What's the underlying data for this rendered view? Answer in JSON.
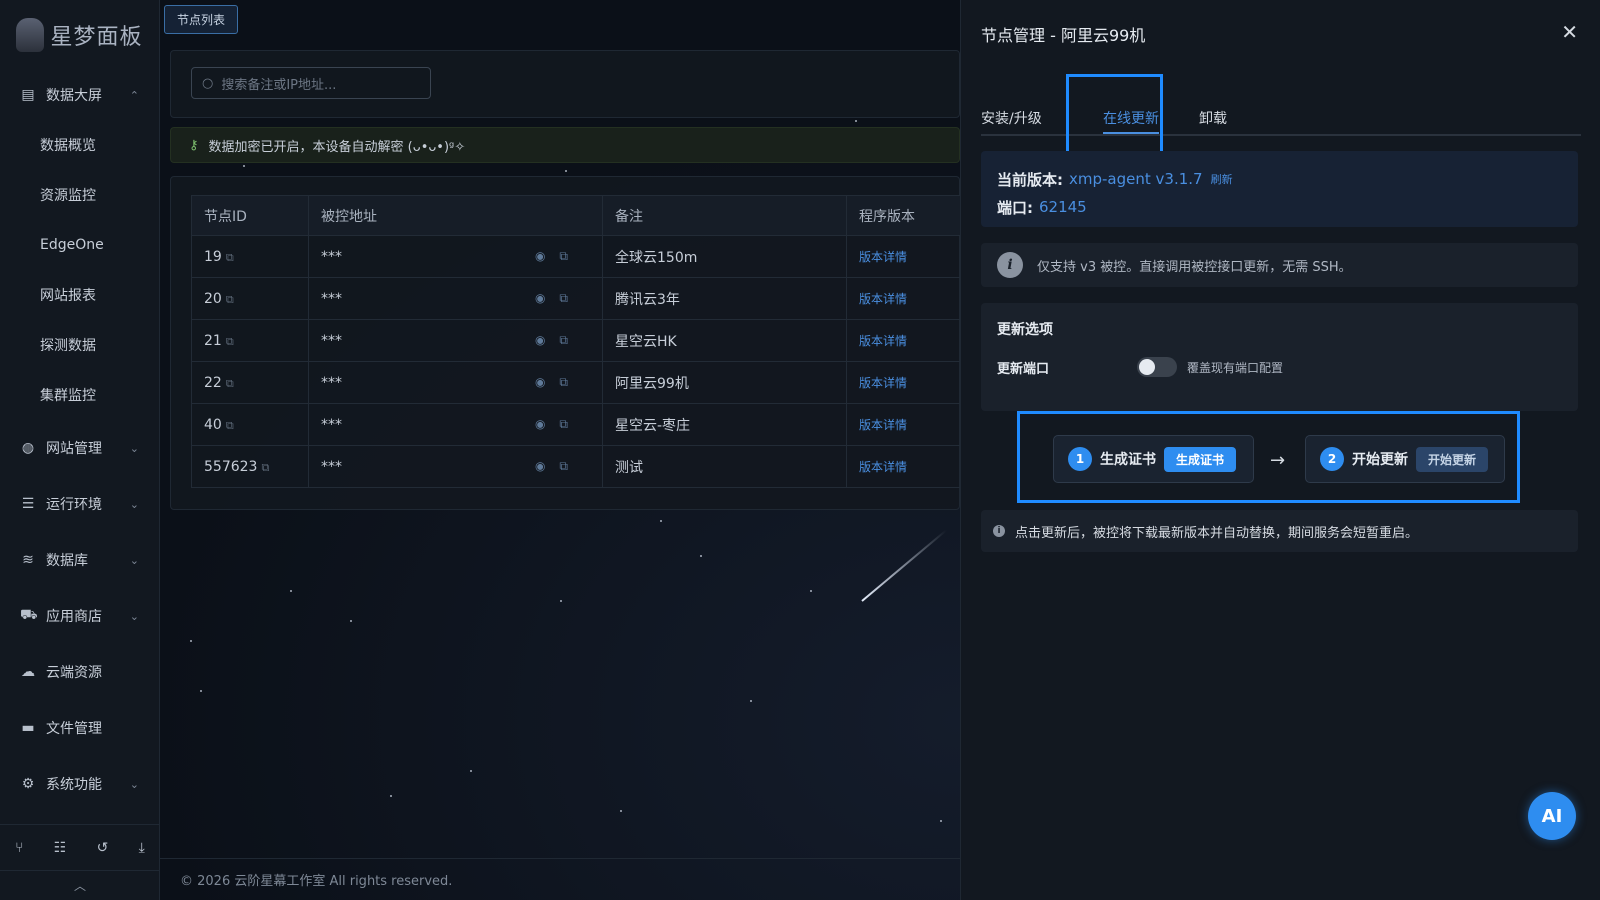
{
  "brand": {
    "name": "星梦面板"
  },
  "sidebar": {
    "groups": [
      {
        "label": "数据大屏",
        "icon": "chart-icon",
        "chev": "⌃"
      },
      {
        "label": "网站管理",
        "icon": "globe-icon",
        "chev": "⌄"
      },
      {
        "label": "运行环境",
        "icon": "server-icon",
        "chev": "⌄"
      },
      {
        "label": "数据库",
        "icon": "database-icon",
        "chev": "⌄"
      },
      {
        "label": "应用商店",
        "icon": "cart-icon",
        "chev": "⌄"
      },
      {
        "label": "云端资源",
        "icon": "cloud-icon",
        "chev": ""
      },
      {
        "label": "文件管理",
        "icon": "folder-icon",
        "chev": ""
      },
      {
        "label": "系统功能",
        "icon": "cogs-icon",
        "chev": "⌄"
      }
    ],
    "sub_items": [
      "数据概览",
      "资源监控",
      "EdgeOne",
      "网站报表",
      "探测数据",
      "集群监控"
    ]
  },
  "main": {
    "tab_tag": "节点列表",
    "search_placeholder": "搜索备注或IP地址...",
    "notice": "数据加密已开启，本设备自动解密 (ᴗ•ᴗ•)ᵍ✧",
    "table": {
      "headers": [
        "节点ID",
        "被控地址",
        "备注",
        "程序版本"
      ],
      "rows": [
        {
          "id": "19",
          "addr": "***",
          "note": "全球云150m",
          "version": "版本详情"
        },
        {
          "id": "20",
          "addr": "***",
          "note": "腾讯云3年",
          "version": "版本详情"
        },
        {
          "id": "21",
          "addr": "***",
          "note": "星空云HK",
          "version": "版本详情"
        },
        {
          "id": "22",
          "addr": "***",
          "note": "阿里云99机",
          "version": "版本详情"
        },
        {
          "id": "40",
          "addr": "***",
          "note": "星空云-枣庄",
          "version": "版本详情"
        },
        {
          "id": "557623",
          "addr": "***",
          "note": "测试",
          "version": "版本详情"
        }
      ]
    },
    "footer": "© 2026 云阶星幕工作室 All rights reserved."
  },
  "drawer": {
    "title": "节点管理 - 阿里云99机",
    "tabs": [
      "安装/升级",
      "在线更新",
      "卸载"
    ],
    "version_label": "当前版本:",
    "version_value": "xmp-agent v3.1.7",
    "refresh": "刷新",
    "port_label": "端口:",
    "port_value": "62145",
    "info": "仅支持 v3 被控。直接调用被控接口更新，无需 SSH。",
    "options_title": "更新选项",
    "option_label": "更新端口",
    "option_hint": "覆盖现有端口配置",
    "step1": {
      "num": "1",
      "label": "生成证书",
      "btn": "生成证书"
    },
    "step2": {
      "num": "2",
      "label": "开始更新",
      "btn": "开始更新"
    },
    "arrow": "→",
    "tip": "点击更新后，被控将下载最新版本并自动替换，期间服务会短暂重启。"
  },
  "ai_button": "AI",
  "colors": {
    "accent": "#2e8df0",
    "highlight": "#1f8bff",
    "link": "#4a8fe0"
  }
}
